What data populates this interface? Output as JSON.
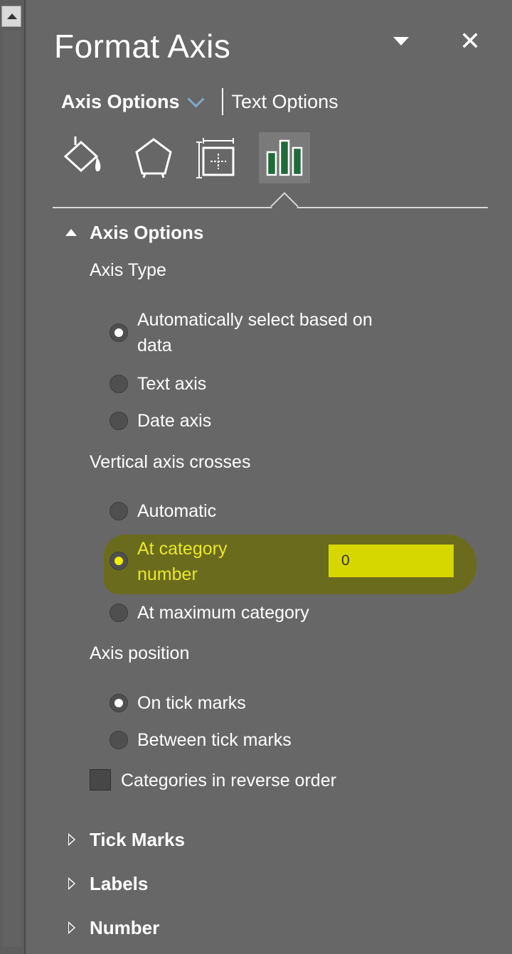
{
  "pane": {
    "title": "Format Axis"
  },
  "tabs": {
    "axis_options": "Axis Options",
    "text_options": "Text Options"
  },
  "icons": [
    "paint-bucket-icon",
    "pentagon-effects-icon",
    "size-properties-icon",
    "bar-chart-icon"
  ],
  "axis_options": {
    "header": "Axis Options",
    "axis_type_label": "Axis Type",
    "axis_type_options": [
      {
        "line1": "Automatically select based on",
        "line2": "data",
        "selected": true
      },
      {
        "label": "Text axis",
        "selected": false
      },
      {
        "label": "Date axis",
        "selected": false
      }
    ],
    "vertical_crosses_label": "Vertical axis crosses",
    "vertical_crosses_options": [
      {
        "label": "Automatic",
        "selected": false
      },
      {
        "line1": "At category",
        "line2": "number",
        "selected": true,
        "value": "0"
      },
      {
        "label": "At maximum category",
        "selected": false
      }
    ],
    "axis_position_label": "Axis position",
    "axis_position_options": [
      {
        "label": "On tick marks",
        "selected": true
      },
      {
        "label": "Between tick marks",
        "selected": false
      }
    ],
    "reverse_order_label": "Categories in reverse order",
    "reverse_order_checked": false
  },
  "collapsed_sections": [
    "Tick Marks",
    "Labels",
    "Number"
  ],
  "colors": {
    "pane_bg": "#676767",
    "highlight": "#6b6b1a",
    "highlight_text": "#e8e82a",
    "input_highlight": "#d6d600",
    "chart_icon_green": "#1f6b3a"
  }
}
